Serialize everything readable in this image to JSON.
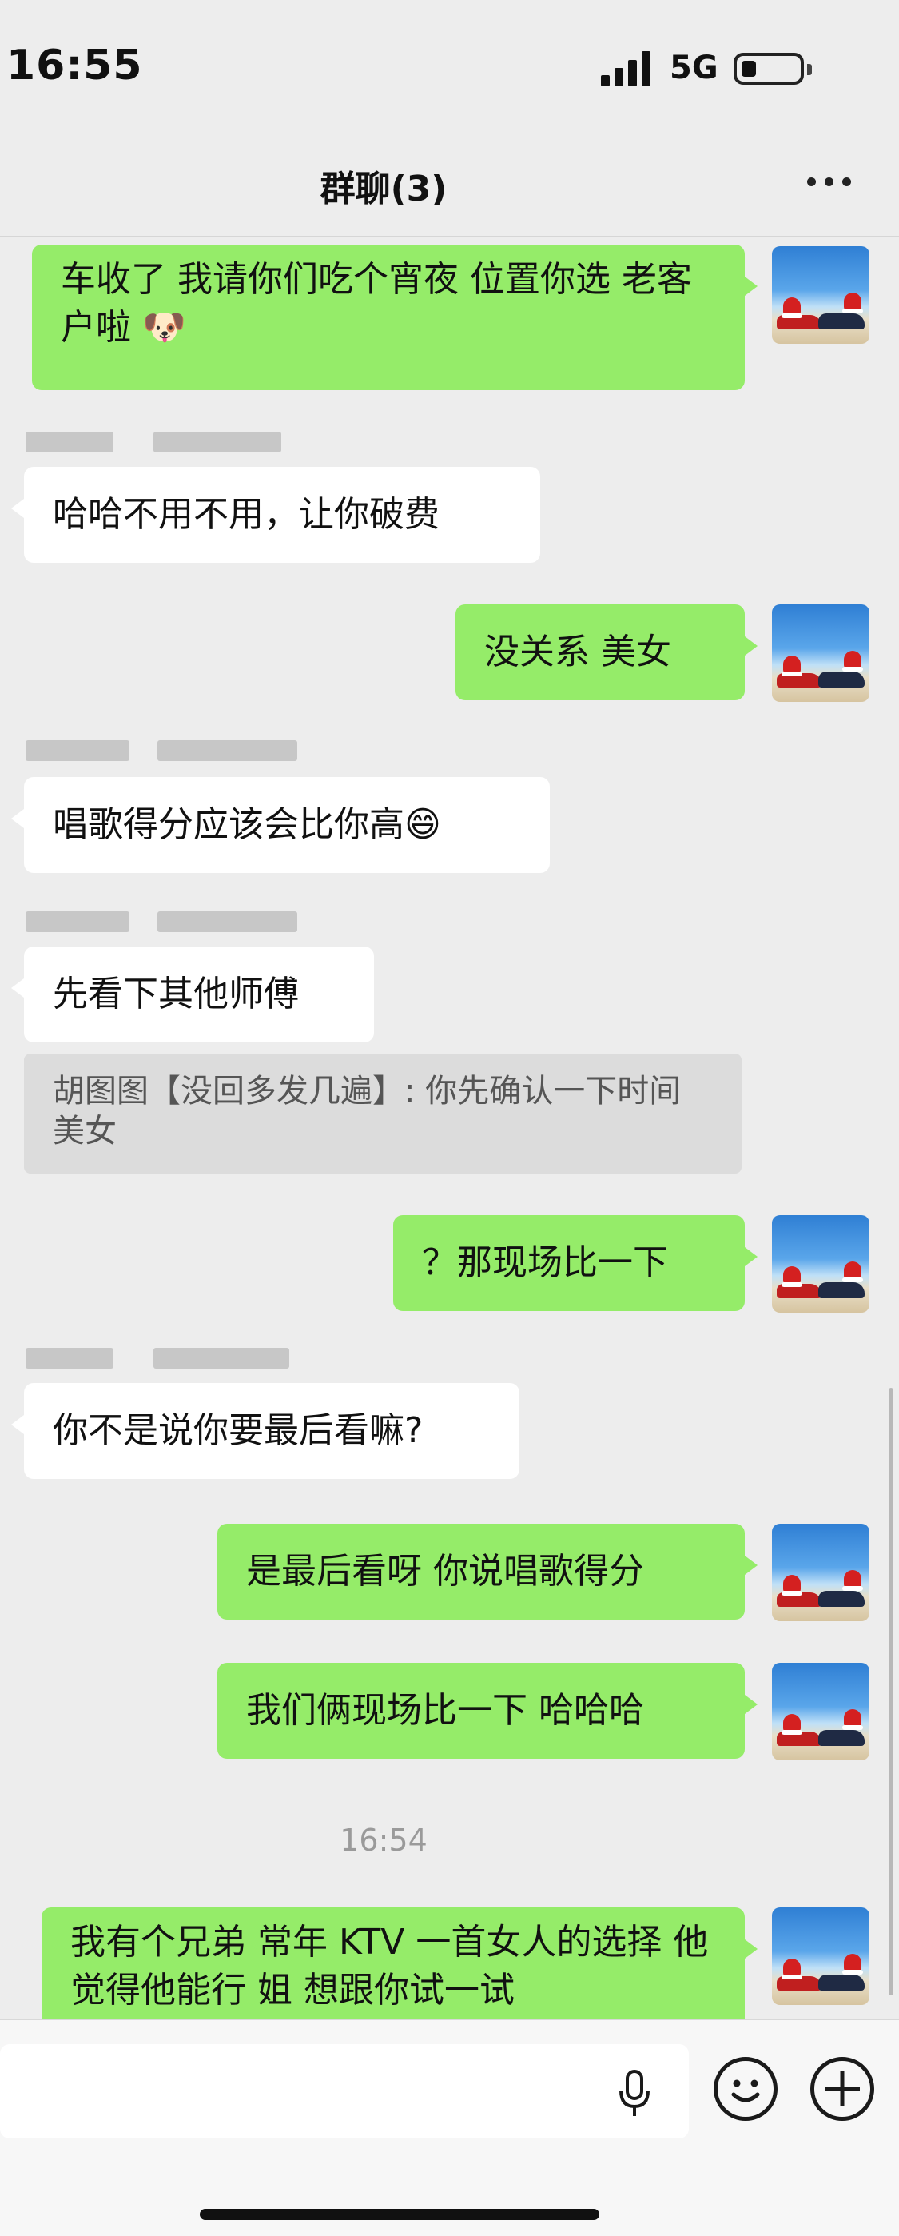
{
  "status_bar": {
    "time": "16:55",
    "network": "5G"
  },
  "header": {
    "title": "群聊(3)"
  },
  "messages": [
    {
      "text": "车收了 我请你们吃个宵夜 位置你选 老客户啦 🐶"
    },
    {
      "text": "哈哈不用不用，让你破费"
    },
    {
      "text": "没关系 美女"
    },
    {
      "text": "唱歌得分应该会比你高😄"
    },
    {
      "text": "先看下其他师傅"
    },
    {
      "text": "？那现场比一下"
    },
    {
      "text": "你不是说你要最后看嘛?"
    },
    {
      "text": "是最后看呀 你说唱歌得分"
    },
    {
      "text": "我们俩现场比一下 哈哈哈"
    },
    {
      "text": "我有个兄弟 常年 KTV 一首女人的选择 他觉得他能行 姐 想跟你试一试"
    }
  ],
  "quote": {
    "text": "胡图图【没回多发几遍】: 你先确认一下时间 美女"
  },
  "timestamp": "16:54",
  "icons": {
    "mic": "microphone-icon",
    "emoji": "emoji-icon",
    "plus": "plus-icon",
    "more": "more-icon"
  },
  "colors": {
    "my_bubble": "#95ec69",
    "other_bubble": "#ffffff",
    "background": "#ededed"
  }
}
